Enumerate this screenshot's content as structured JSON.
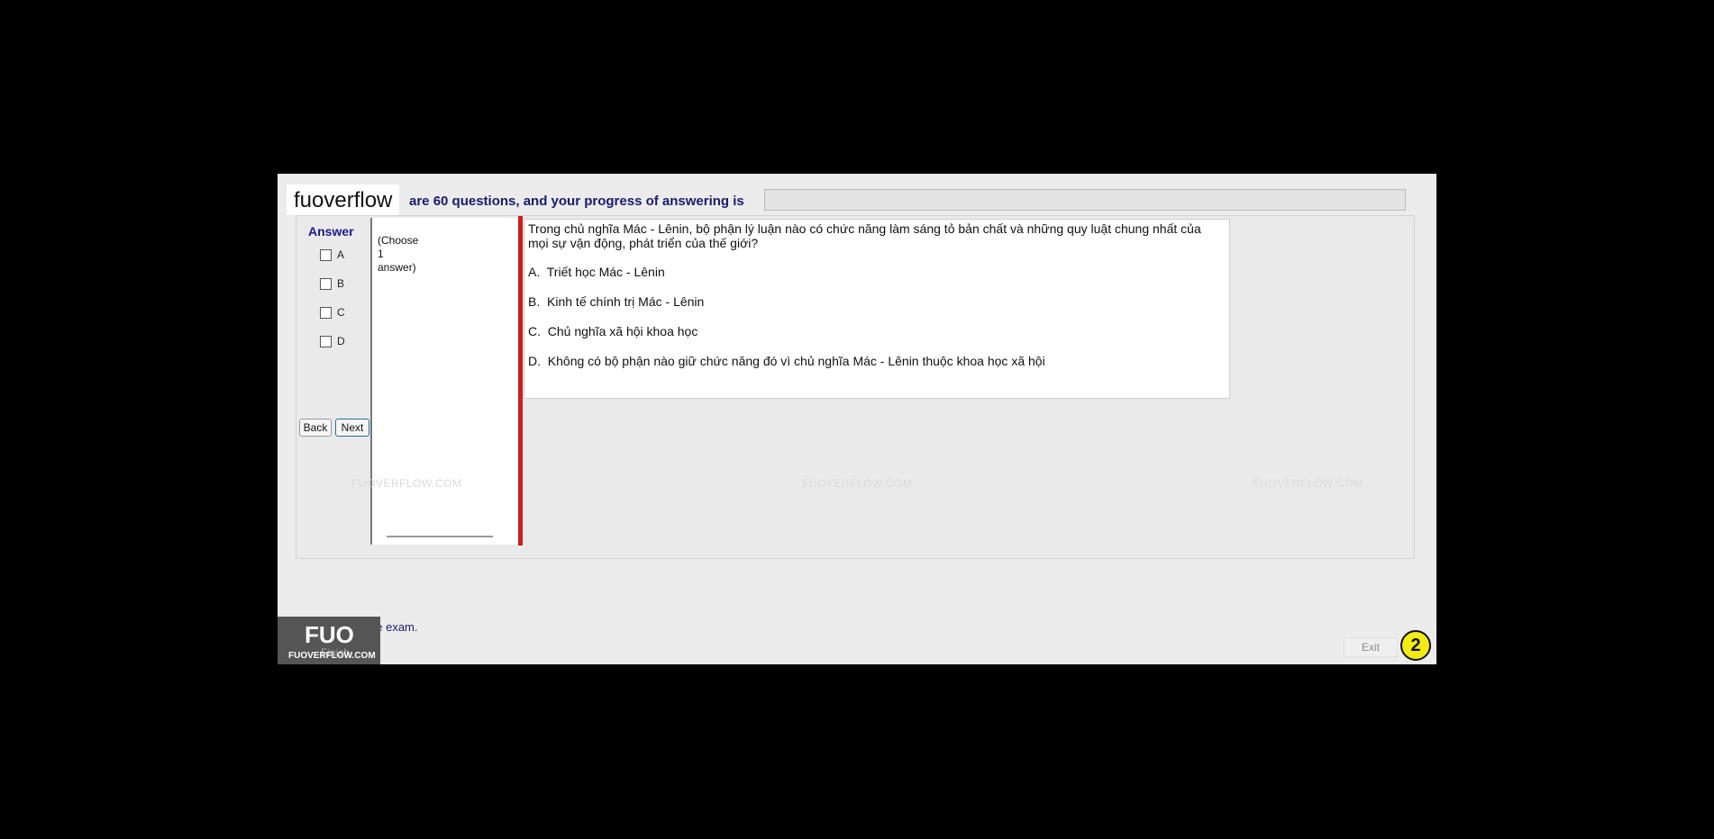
{
  "brand": {
    "watermark_label": "fuoverflow"
  },
  "header": {
    "progress_text": "are 60 questions, and your progress of answering is"
  },
  "answer_panel": {
    "title": "Answer",
    "options": [
      "A",
      "B",
      "C",
      "D"
    ],
    "back_label": "Back",
    "next_label": "Next"
  },
  "instructions": {
    "choose": "(Choose\n1\nanswer)"
  },
  "question": {
    "text": "Trong chủ nghĩa Mác - Lênin, bộ phận lý luận nào có chức năng làm sáng tỏ bản chất và những quy luật chung nhất của mọi sự vận động, phát triển của thế giới?",
    "options": [
      {
        "letter": "A.",
        "text": "Triết học Mác - Lênin"
      },
      {
        "letter": "B.",
        "text": "Kinh tế chính trị Mác - Lênin"
      },
      {
        "letter": "C.",
        "text": "Chủ nghĩa xã hội khoa học"
      },
      {
        "letter": "D.",
        "text": "Không có bộ phận nào giữ chức năng đó vì chủ nghĩa Mác - Lênin thuộc khoa học xã hội"
      }
    ]
  },
  "watermarks": {
    "site": "FUOVERFLOW.COM"
  },
  "footer": {
    "finish_text": "to finish the exam.",
    "finish_button": "Finish",
    "logo_main": "FUO",
    "logo_sub": "FUOVERFLOW.COM",
    "exit_label": "Exit",
    "page_number": "2"
  },
  "colors": {
    "accent": "#1a1a8e",
    "red_divider": "#cc1e1e",
    "badge": "#f2ec16"
  }
}
